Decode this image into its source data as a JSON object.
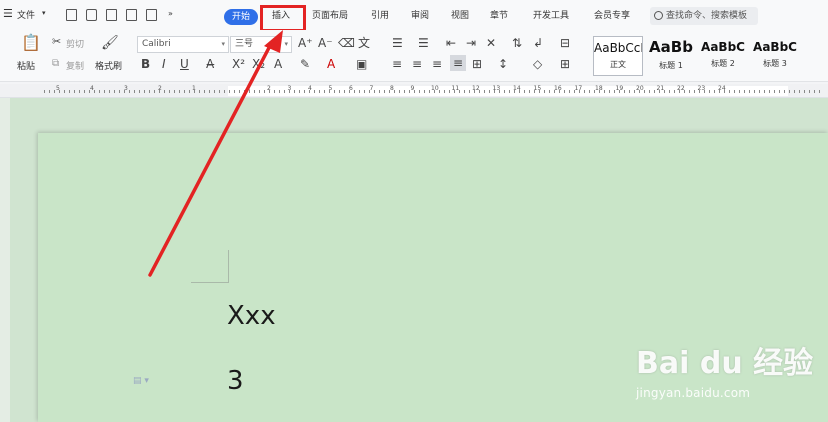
{
  "menubar": {
    "file_label": "文件",
    "tabs": [
      {
        "label": "开始"
      },
      {
        "label": "插入"
      },
      {
        "label": "页面布局"
      },
      {
        "label": "引用"
      },
      {
        "label": "审阅"
      },
      {
        "label": "视图"
      },
      {
        "label": "章节"
      },
      {
        "label": "开发工具"
      },
      {
        "label": "会员专享"
      }
    ],
    "search_placeholder": "查找命令、搜索模板"
  },
  "ribbon": {
    "paste_label": "粘贴",
    "cut_label": "剪切",
    "copy_label": "复制",
    "format_painter_label": "格式刷",
    "font_name": "Calibri",
    "font_size": "三号",
    "styles": [
      {
        "preview": "AaBbCcDd",
        "name": "正文"
      },
      {
        "preview": "AaBb",
        "name": "标题 1"
      },
      {
        "preview": "AaBbC",
        "name": "标题 2"
      },
      {
        "preview": "AaBbC",
        "name": "标题 3"
      }
    ]
  },
  "ruler": {
    "numbers": [
      "5",
      "4",
      "3",
      "2",
      "1",
      "1",
      "2",
      "3",
      "4",
      "5",
      "6",
      "7",
      "8",
      "9",
      "10",
      "11",
      "12",
      "13",
      "14",
      "15",
      "16",
      "17",
      "18",
      "19",
      "20",
      "21",
      "22",
      "23",
      "24"
    ]
  },
  "document": {
    "line1": "Xxx",
    "line2": "3"
  },
  "watermark": {
    "logo_text": "Bai du 经验",
    "url": "jingyan.baidu.com"
  },
  "annotation": {
    "highlight_color": "#e32323",
    "target": "插入"
  }
}
